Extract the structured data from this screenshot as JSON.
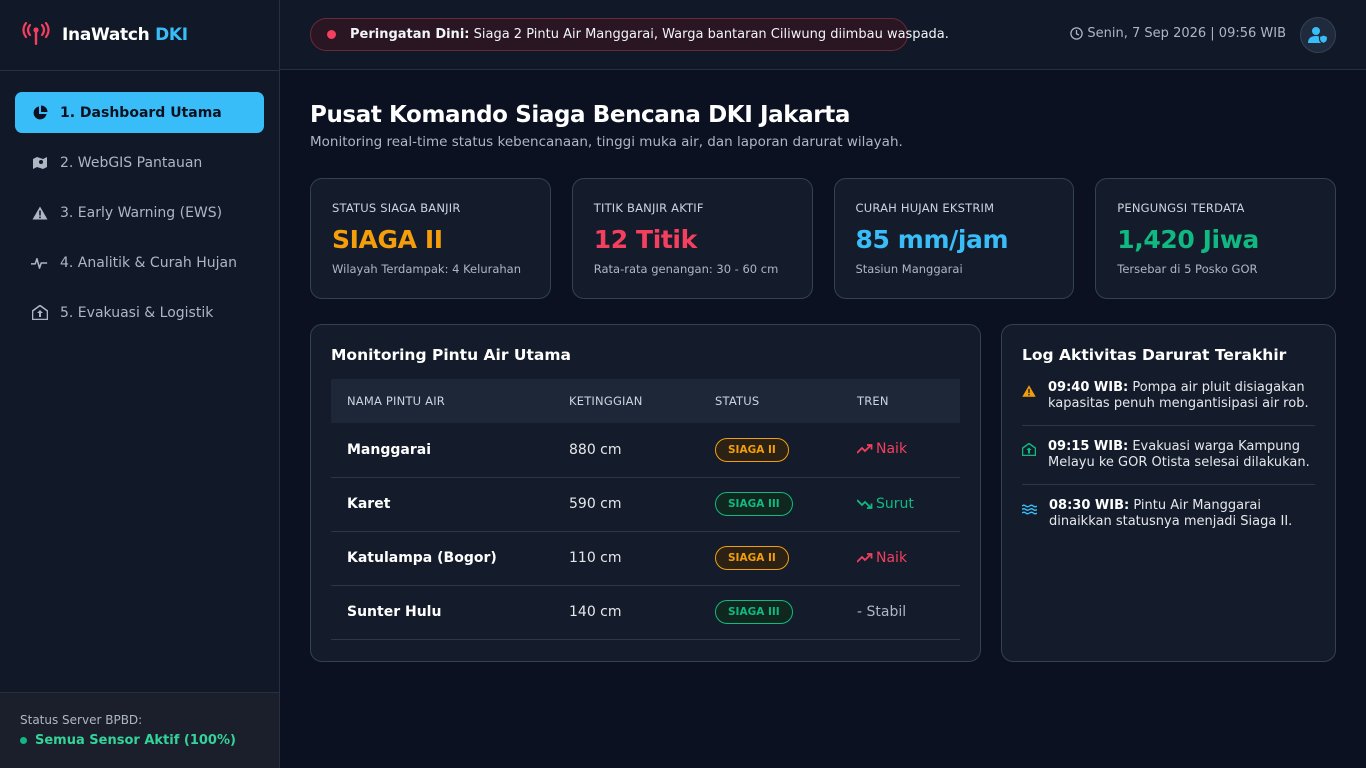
{
  "brand": {
    "name": "InaWatch",
    "accent": "DKI"
  },
  "nav": [
    {
      "label": "1. Dashboard Utama",
      "icon": "pie-chart-icon"
    },
    {
      "label": "2. WebGIS Pantauan",
      "icon": "map-icon"
    },
    {
      "label": "3. Early Warning (EWS)",
      "icon": "warning-icon"
    },
    {
      "label": "4. Analitik & Curah Hujan",
      "icon": "pulse-icon"
    },
    {
      "label": "5. Evakuasi & Logistik",
      "icon": "shelter-icon"
    }
  ],
  "server": {
    "label": "Status Server BPBD:",
    "status": "Semua Sensor Aktif (100%)"
  },
  "alert": {
    "label": "Peringatan Dini:",
    "message": "Siaga 2 Pintu Air Manggarai, Warga bantaran Ciliwung diimbau waspada."
  },
  "datetime": "Senin, 7 Sep 2026 | 09:56 WIB",
  "page": {
    "title": "Pusat Komando Siaga Bencana DKI Jakarta",
    "subtitle": "Monitoring real-time status kebencanaan, tinggi muka air, dan laporan darurat wilayah."
  },
  "stats": [
    {
      "label": "STATUS SIAGA BANJIR",
      "value": "SIAGA II",
      "desc": "Wilayah Terdampak: 4 Kelurahan",
      "color": "#f59e0b"
    },
    {
      "label": "TITIK BANJIR AKTIF",
      "value": "12 Titik",
      "desc": "Rata-rata genangan: 30 - 60 cm",
      "color": "#f43f5e"
    },
    {
      "label": "CURAH HUJAN EKSTRIM",
      "value": "85 mm/jam",
      "desc": "Stasiun Manggarai",
      "color": "#38bdf8"
    },
    {
      "label": "PENGUNGSI TERDATA",
      "value": "1,420 Jiwa",
      "desc": "Tersebar di 5 Posko GOR",
      "color": "#10b981"
    }
  ],
  "gates": {
    "title": "Monitoring Pintu Air Utama",
    "columns": [
      "NAMA PINTU AIR",
      "KETINGGIAN",
      "STATUS",
      "TREN"
    ],
    "rows": [
      {
        "name": "Manggarai",
        "level": "880 cm",
        "status": "SIAGA II",
        "trend": "Naik"
      },
      {
        "name": "Karet",
        "level": "590 cm",
        "status": "SIAGA III",
        "trend": "Surut"
      },
      {
        "name": "Katulampa (Bogor)",
        "level": "110 cm",
        "status": "SIAGA II",
        "trend": "Naik"
      },
      {
        "name": "Sunter Hulu",
        "level": "140 cm",
        "status": "SIAGA III",
        "trend": "- Stabil"
      }
    ]
  },
  "log": {
    "title": "Log Aktivitas Darurat Terakhir",
    "items": [
      {
        "time": "09:40 WIB:",
        "text": "Pompa air pluit disiagakan kapasitas penuh mengantisipasi air rob.",
        "icon": "warning-icon"
      },
      {
        "time": "09:15 WIB:",
        "text": "Evakuasi warga Kampung Melayu ke GOR Otista selesai dilakukan.",
        "icon": "shelter-icon"
      },
      {
        "time": "08:30 WIB:",
        "text": "Pintu Air Manggarai dinaikkan statusnya menjadi Siaga II.",
        "icon": "water-icon"
      }
    ]
  }
}
